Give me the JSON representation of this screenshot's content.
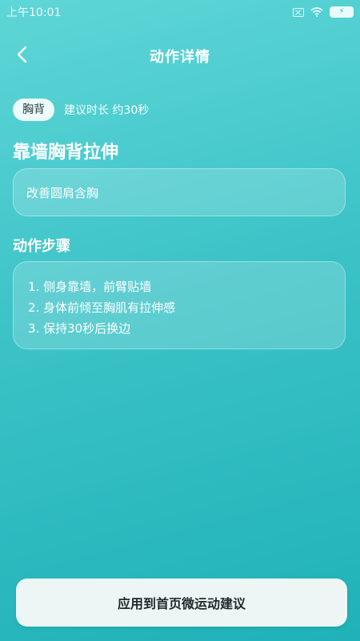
{
  "status_bar": {
    "time": "上午10:01",
    "icons": [
      "sim-icon",
      "wifi-icon",
      "battery-charging-icon"
    ]
  },
  "header": {
    "title": "动作详情",
    "back_icon": "chevron-left-icon"
  },
  "exercise": {
    "tag": "胸背",
    "duration": "建议时长 约30秒",
    "name": "靠墙胸背拉伸",
    "benefit": "改善圆肩含胸"
  },
  "steps": {
    "title": "动作步骤",
    "items": [
      "1. 侧身靠墙，前臂贴墙",
      "2. 身体前倾至胸肌有拉伸感",
      "3. 保持30秒后换边"
    ]
  },
  "action": {
    "apply_label": "应用到首页微运动建议"
  },
  "colors": {
    "background_top": "#5fd6d7",
    "background_bottom": "#1fb2b8",
    "button_bg": "#edf6f5",
    "tag_bg": "#ecfcfb"
  }
}
